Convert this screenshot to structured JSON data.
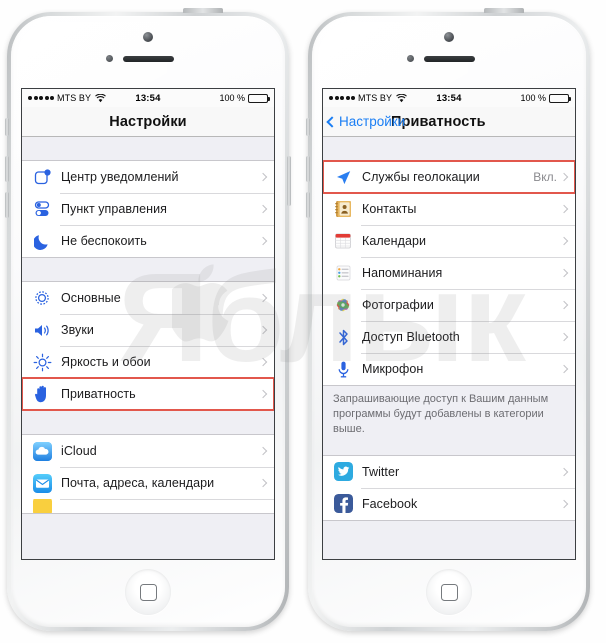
{
  "meta": {
    "watermark_text": "Яблык",
    "watermark_apple": "",
    "highlight_color": "#e2574c",
    "accent_blue": "#1a7ef4"
  },
  "status_bar": {
    "carrier": "MTS BY",
    "time": "13:54",
    "battery_percent": "100 %",
    "signal_dots": 5,
    "wifi_icon": "wifi-icon"
  },
  "left_phone": {
    "nav": {
      "title": "Настройки"
    },
    "groups": [
      {
        "rows": [
          {
            "label": "Центр уведомлений",
            "icon": "notification-center-icon",
            "value": ""
          },
          {
            "label": "Пункт управления",
            "icon": "control-center-icon",
            "value": ""
          },
          {
            "label": "Не беспокоить",
            "icon": "do-not-disturb-moon-icon",
            "value": ""
          }
        ]
      },
      {
        "rows": [
          {
            "label": "Основные",
            "icon": "gear-icon",
            "value": ""
          },
          {
            "label": "Звуки",
            "icon": "speaker-icon",
            "value": ""
          },
          {
            "label": "Яркость и обои",
            "icon": "brightness-sun-icon",
            "value": ""
          },
          {
            "label": "Приватность",
            "icon": "hand-privacy-icon",
            "value": "",
            "highlighted": true
          }
        ]
      },
      {
        "rows": [
          {
            "label": "iCloud",
            "icon": "icloud-icon",
            "value": ""
          },
          {
            "label": "Почта, адреса, календари",
            "icon": "mail-icon",
            "value": ""
          },
          {
            "label": "",
            "icon": "notes-icon",
            "value": ""
          }
        ]
      }
    ]
  },
  "right_phone": {
    "nav": {
      "back_label": "Настройки",
      "title": "Приватность"
    },
    "groups": [
      {
        "rows": [
          {
            "label": "Службы геолокации",
            "icon": "location-arrow-icon",
            "value": "Вкл.",
            "highlighted": true
          },
          {
            "label": "Контакты",
            "icon": "contacts-icon",
            "value": ""
          },
          {
            "label": "Календари",
            "icon": "calendar-icon",
            "value": ""
          },
          {
            "label": "Напоминания",
            "icon": "reminders-icon",
            "value": ""
          },
          {
            "label": "Фотографии",
            "icon": "photos-icon",
            "value": ""
          },
          {
            "label": "Доступ Bluetooth",
            "icon": "bluetooth-icon",
            "value": ""
          },
          {
            "label": "Микрофон",
            "icon": "microphone-icon",
            "value": ""
          }
        ]
      }
    ],
    "footnote": "Запрашивающие доступ к Вашим данным программы будут добавлены в категории выше.",
    "social_group": {
      "rows": [
        {
          "label": "Twitter",
          "icon": "twitter-icon",
          "value": ""
        },
        {
          "label": "Facebook",
          "icon": "facebook-icon",
          "value": ""
        }
      ]
    }
  }
}
